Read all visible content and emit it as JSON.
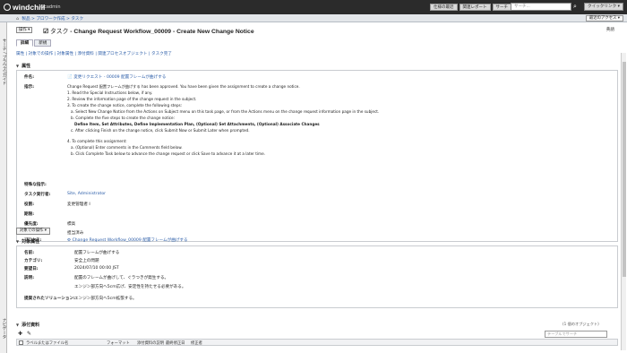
{
  "topbar": {
    "logo": "windchill",
    "user": "wcadmin",
    "menus": [
      "仕様の最近",
      "関連レポート",
      "サーチ"
    ],
    "search_placeholder": "サーチ...",
    "quick_access": "クイックリンク ▾"
  },
  "breadcrumb": {
    "items": [
      "製品",
      "プロワーク作成",
      "タスク"
    ]
  },
  "recent_access": "最近のアクセス ▾",
  "leftnav": {
    "top_label": "サーチ / ブラウズ/ガイド",
    "bottom_label": "ナビゲータ"
  },
  "header": {
    "ops_label": "操作 ▾",
    "title_prefix": "タスク",
    "title": "Change Request Workflow_00009 - Create New Change Notice",
    "right_label": "英語"
  },
  "tabs": [
    {
      "label": "詳細"
    },
    {
      "label": "新規"
    }
  ],
  "action_links": "属性 | 対象での操作 | 対象属性 | 添付資料 | 関連プロセスオブジェクト | タスク完了",
  "attributes": {
    "section_title": "属性",
    "subject_label": "件名:",
    "subject_value": "変更リクエスト - 00009 配置フレームが曲げする",
    "instr_label": "指示:",
    "instructions": [
      "Change Request 配置フレームが曲げする has been approved. You have been given the assignment to create a change notice.",
      "1. Read the Special Instructions below, if any.",
      "2. Review the information page of the change request in the subject.",
      "3. To create the change notice, complete the following steps:",
      "a. Select New Change Notice from the Actions on Subject menu on this task page, or from the Actions menu on the change request information page in the subject.",
      "b. Complete the five steps to create the change notice:",
      "Define Item, Set Attributes, Define Implementation Plan, (Optional) Set Attachments, (Optional) Associate Changes",
      "c. After clicking Finish on the change notice, click Submit Now or Submit Later when prompted.",
      "4. To complete this assignment:",
      "a. (Optional) Enter comments in the Comments field below.",
      "b. Click Complete Task below to advance the change request or click Save to advance it at a later time."
    ],
    "special_label": "特殊な指示:",
    "assignee_label": "タスク実行者:",
    "assignee_value": "Site, Administrator",
    "role_label": "役割:",
    "role_value": "変更管理者 I",
    "deadline_label": "期限:",
    "deadline_value": "",
    "priority_label": "優先度:",
    "priority_value": "標高",
    "status_label": "ステータス:",
    "status_value": "担当済み",
    "process_label": "プロセス:",
    "process_value": "Change Request Workflow_00009 配置フレームが曲げする"
  },
  "subject_ops_label": "対象での操作 ▾",
  "subject_attrs": {
    "section_title": "対象属性",
    "name_label": "名前:",
    "name_value": "配置フレームが曲げする",
    "category_label": "カテゴリ:",
    "category_value": "安全上の問題",
    "date_label": "要望日:",
    "date_value": "2024/07/10 00:00 JST",
    "desc_label": "説明:",
    "desc_value1": "配置のフレームが曲げして、ぐラつきが発生する。",
    "desc_value2": "エンジン部方向へ5cm広げ、安定性を持たせる必要がある。",
    "solution_label": "提案されたソリューション:",
    "solution_value": "エンジン部方向へ5cm拡張する。"
  },
  "attachments": {
    "section_title": "添付資料",
    "count_label": "(1 個のオブジェクト)",
    "filter_placeholder": "テーブルでサーチ",
    "columns": [
      "ラベルまたはファイル名",
      "フォーマット",
      "添付資料の説明",
      "最終修正日",
      "修正者"
    ]
  }
}
